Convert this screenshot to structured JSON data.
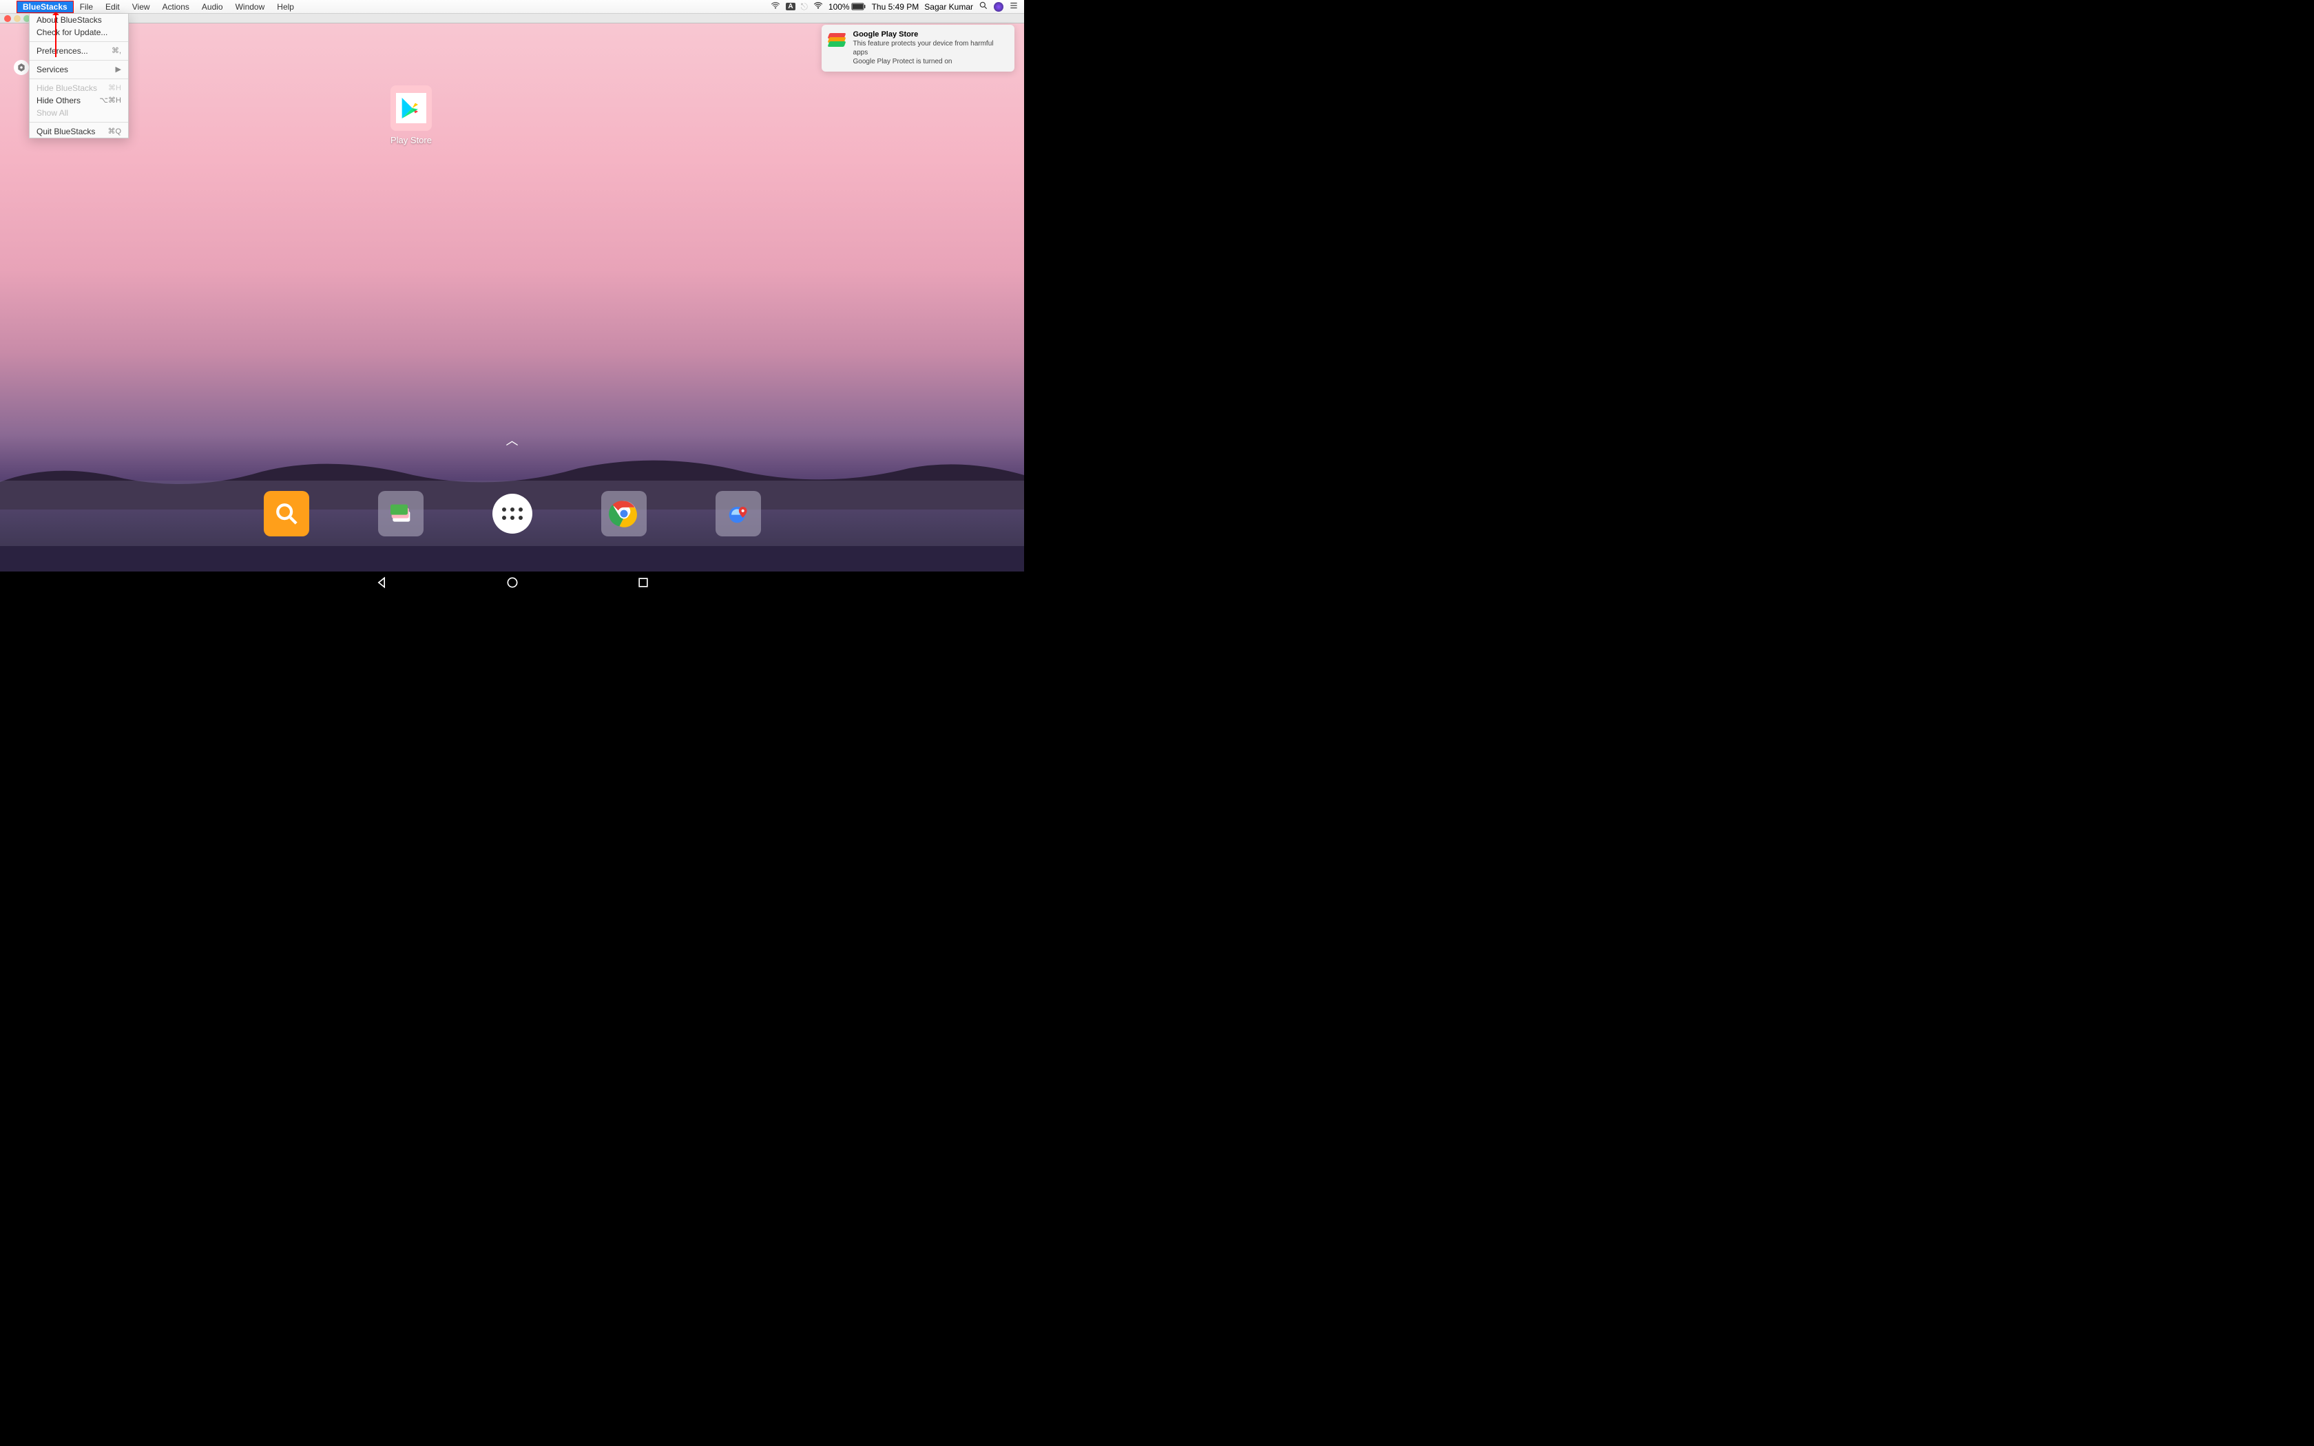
{
  "menubar": {
    "app_name": "BlueStacks",
    "items": [
      "File",
      "Edit",
      "View",
      "Actions",
      "Audio",
      "Window",
      "Help"
    ],
    "battery_pct": "100%",
    "datetime": "Thu 5:49 PM",
    "user": "Sagar Kumar"
  },
  "dropdown": {
    "about": "About BlueStacks",
    "check_update": "Check for Update...",
    "preferences": "Preferences...",
    "preferences_sc": "⌘,",
    "services": "Services",
    "hide": "Hide BlueStacks",
    "hide_sc": "⌘H",
    "hide_others": "Hide Others",
    "hide_others_sc": "⌥⌘H",
    "show_all": "Show All",
    "quit": "Quit BlueStacks",
    "quit_sc": "⌘Q"
  },
  "notif": {
    "title": "Google Play Store",
    "line1": "This feature protects your device from harmful apps",
    "line2": "Google Play Protect is turned on"
  },
  "home_app": {
    "label": "Play Store"
  }
}
